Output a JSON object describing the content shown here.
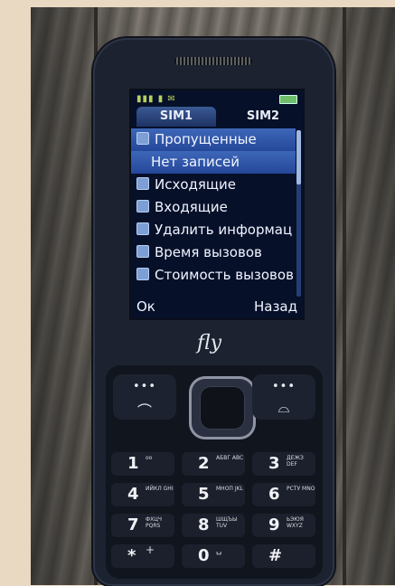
{
  "screen": {
    "tabs": [
      "SIM1",
      "SIM2"
    ],
    "menu": [
      {
        "label": "Пропущенные",
        "selected": true
      },
      {
        "label": "Нет записей",
        "selected": true,
        "sub": true
      },
      {
        "label": "Исходящие"
      },
      {
        "label": "Входящие"
      },
      {
        "label": "Удалить информац"
      },
      {
        "label": "Время вызовов"
      },
      {
        "label": "Стоимость вызовов"
      }
    ],
    "softkeys": {
      "left": "Ок",
      "right": "Назад"
    }
  },
  "brand": "fly",
  "keypad": {
    "keys": [
      {
        "num": "1",
        "letters": "ᴏᴏ"
      },
      {
        "num": "2",
        "letters": "АБВГ ABC"
      },
      {
        "num": "3",
        "letters": "ДЕЖЗ DEF"
      },
      {
        "num": "4",
        "letters": "ИЙКЛ GHI"
      },
      {
        "num": "5",
        "letters": "МНОП JKL"
      },
      {
        "num": "6",
        "letters": "РСТУ MNO"
      },
      {
        "num": "7",
        "letters": "ФХЦЧ PQRS"
      },
      {
        "num": "8",
        "letters": "ШЩЪЫ TUV"
      },
      {
        "num": "9",
        "letters": "ЬЭЮЯ WXYZ"
      },
      {
        "num": "*",
        "letters": "+"
      },
      {
        "num": "0",
        "letters": "␣"
      },
      {
        "num": "#",
        "letters": ""
      }
    ],
    "softkeys": {
      "left_symbol": "•••",
      "right_symbol": "•••"
    }
  }
}
